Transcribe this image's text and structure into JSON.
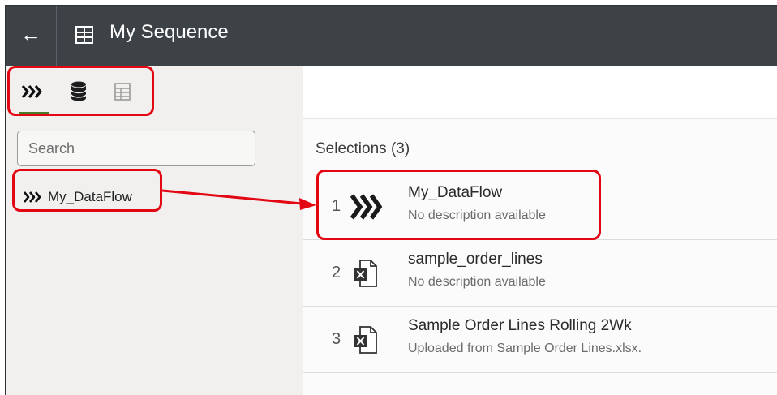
{
  "header": {
    "back_icon": "back-arrow-icon",
    "sequence_icon": "sequence-icon",
    "title": "My Sequence"
  },
  "sidebar": {
    "tabs": [
      {
        "icon": "data-flow-icon",
        "selected": true
      },
      {
        "icon": "database-icon",
        "selected": false
      },
      {
        "icon": "dataset-icon",
        "selected": false
      }
    ],
    "search": {
      "placeholder": "Search",
      "value": ""
    },
    "items": [
      {
        "icon": "data-flow-icon",
        "label": "My_DataFlow"
      }
    ]
  },
  "main": {
    "selections_header": "Selections (3)",
    "rows": [
      {
        "index": "1",
        "icon": "data-flow-icon",
        "name": "My_DataFlow",
        "description": "No description available"
      },
      {
        "index": "2",
        "icon": "excel-file-icon",
        "name": "sample_order_lines",
        "description": "No description available"
      },
      {
        "index": "3",
        "icon": "excel-file-icon",
        "name": "Sample Order Lines Rolling 2Wk",
        "description": "Uploaded from Sample Order Lines.xlsx."
      }
    ]
  },
  "colors": {
    "titlebar": "#3d4247",
    "sidebar": "#f1f0ef",
    "tab_underline": "#4b7a2d",
    "annotation": "#e30613"
  }
}
